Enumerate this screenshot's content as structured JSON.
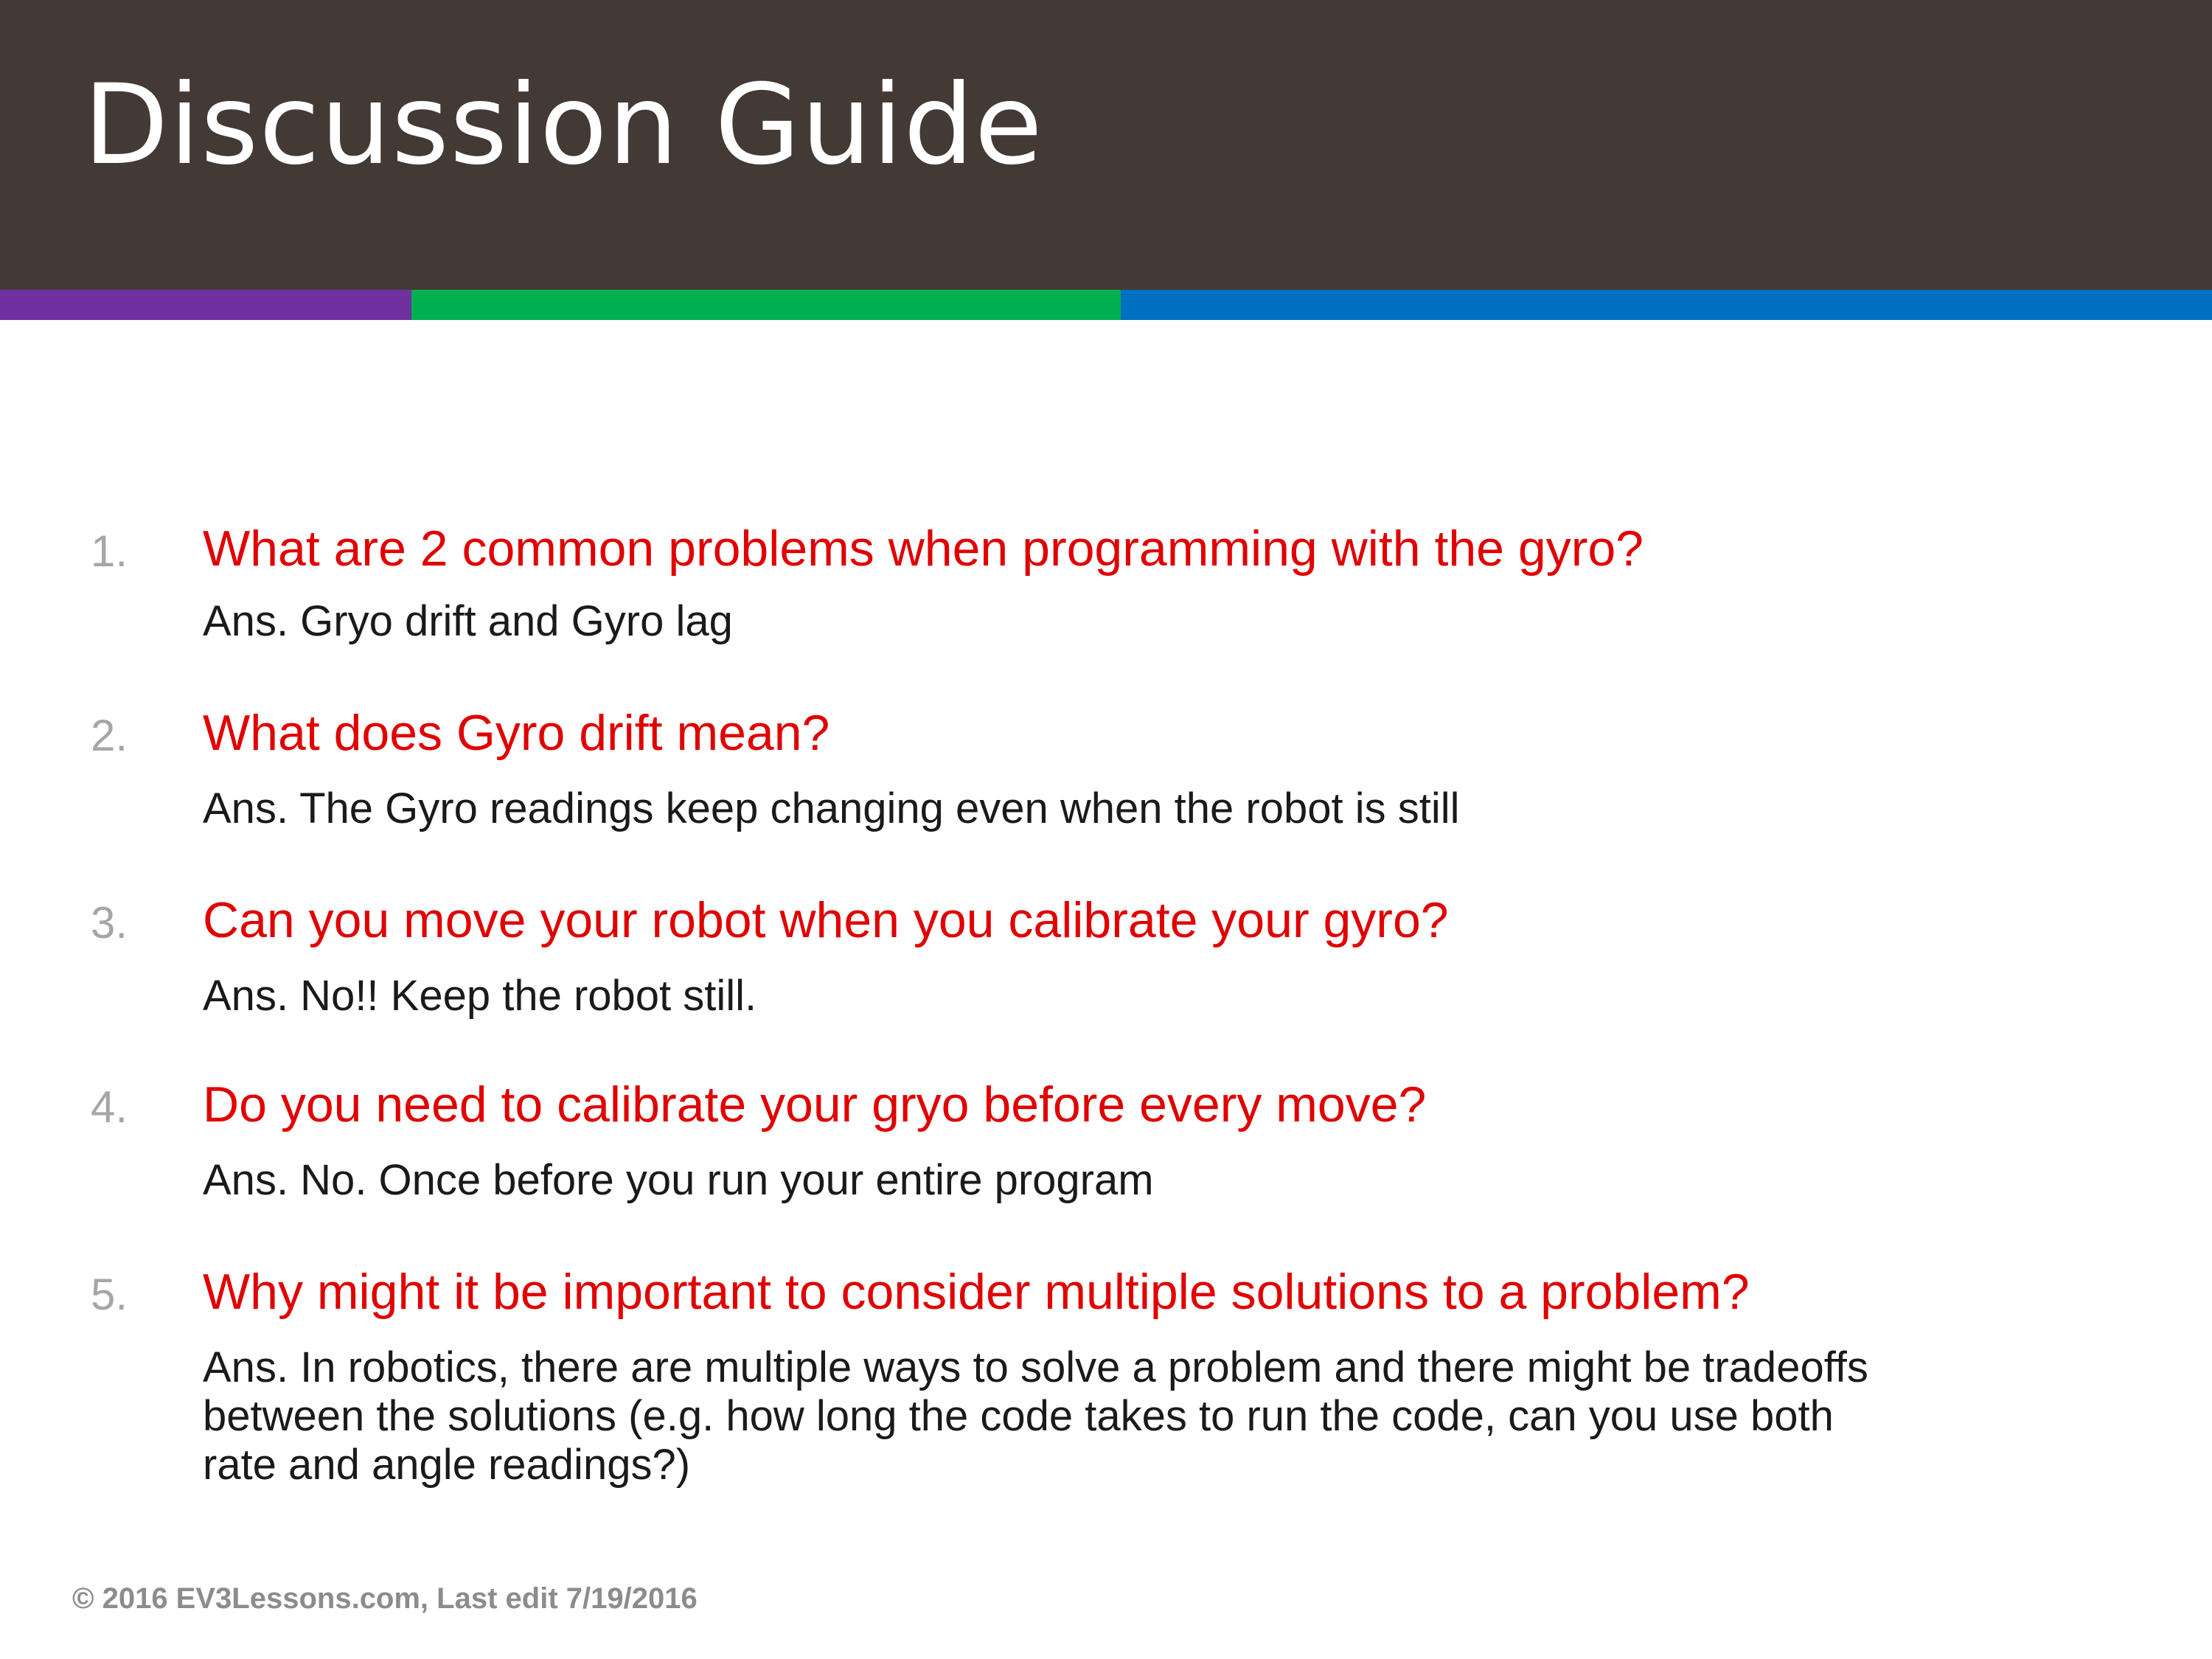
{
  "title": "Discussion Guide",
  "items": [
    {
      "number": "1.",
      "question": "What are 2 common problems when programming with the gyro?",
      "answer": [
        "Ans. Gryo drift and Gyro lag"
      ]
    },
    {
      "number": "2.",
      "question": "What does Gyro drift mean?",
      "answer": [
        "Ans. The Gyro readings keep changing even when the robot is still"
      ]
    },
    {
      "number": "3.",
      "question": "Can you move your robot when you calibrate your gyro?",
      "answer": [
        "Ans. No!!  Keep the robot still."
      ]
    },
    {
      "number": "4.",
      "question": "Do you need to calibrate your gryo before every move?",
      "answer": [
        "Ans. No. Once before you run your entire program"
      ]
    },
    {
      "number": "5.",
      "question": "Why might it be important to consider multiple solutions to a problem?",
      "answer": [
        "Ans. In robotics, there are multiple ways to solve a problem and there might be tradeoffs",
        "between the solutions (e.g. how long the code takes to run the code, can you use both",
        "rate and angle readings?)"
      ]
    }
  ],
  "footer": "© 2016 EV3Lessons.com, Last edit 7/19/2016",
  "colors": {
    "header_bg": "#433a35",
    "stripe_purple": "#7030a0",
    "stripe_green": "#00b050",
    "stripe_blue": "#0070c0",
    "question_text": "#e00000",
    "number_text": "#a6a6a6"
  }
}
